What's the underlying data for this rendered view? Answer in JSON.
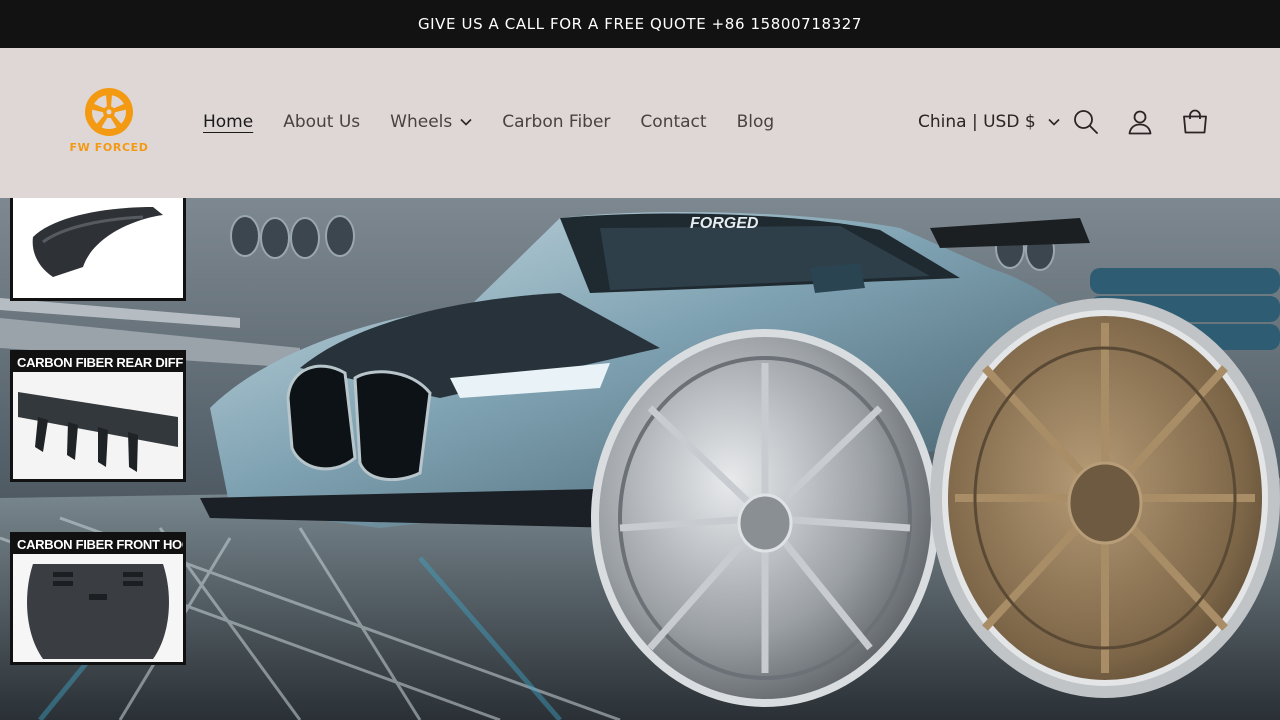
{
  "announcement": {
    "text": "GIVE US A CALL FOR A FREE QUOTE +86 15800718327"
  },
  "brand": {
    "name": "FW FORCED",
    "color": "#f39a12"
  },
  "nav": {
    "items": [
      {
        "label": "Home",
        "active": true
      },
      {
        "label": "About Us"
      },
      {
        "label": "Wheels",
        "has_dropdown": true
      },
      {
        "label": "Carbon Fiber"
      },
      {
        "label": "Contact"
      },
      {
        "label": "Blog"
      }
    ]
  },
  "locale": {
    "label": "China | USD $"
  },
  "icons": {
    "search": "search-icon",
    "account": "user-icon",
    "cart": "cart-icon"
  },
  "hero": {
    "car_decal": "FORGED",
    "insets": [
      {
        "label": ""
      },
      {
        "label": "CARBON FIBER REAR DIFFUSER"
      },
      {
        "label": "CARBON FIBER FRONT HOOD"
      }
    ]
  },
  "colors": {
    "announcement_bg": "#121212",
    "header_bg": "#dfd6d6"
  }
}
